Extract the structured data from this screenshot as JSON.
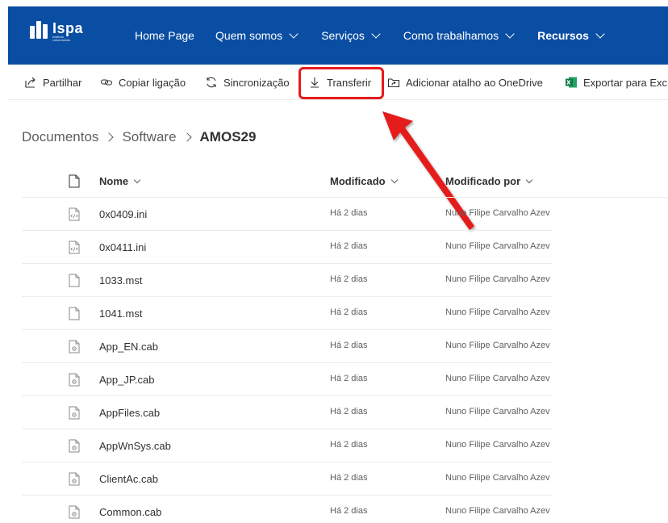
{
  "header": {
    "logo_name": "Ispa",
    "logo_sub_1": "Instituto",
    "logo_sub_2": "Universitário",
    "nav": [
      {
        "label": "Home Page",
        "has_chevron": false,
        "active": false
      },
      {
        "label": "Quem somos",
        "has_chevron": true,
        "active": false
      },
      {
        "label": "Serviços",
        "has_chevron": true,
        "active": false
      },
      {
        "label": "Como trabalhamos",
        "has_chevron": true,
        "active": false
      },
      {
        "label": "Recursos",
        "has_chevron": true,
        "active": true
      }
    ],
    "color": "#0a4ea3"
  },
  "commandbar": {
    "partilhar": {
      "label": "Partilhar",
      "icon": "share-icon"
    },
    "copiar": {
      "label": "Copiar ligação",
      "icon": "link-icon"
    },
    "sincronizacao": {
      "label": "Sincronização",
      "icon": "sync-icon"
    },
    "transferir": {
      "label": "Transferir",
      "icon": "download-icon"
    },
    "onedrive": {
      "label": "Adicionar atalho ao OneDrive",
      "icon": "shortcut-icon"
    },
    "exportar": {
      "label": "Exportar para Exc",
      "icon": "excel-icon"
    }
  },
  "annotation": {
    "color": "#e51b1b",
    "target": "Transferir"
  },
  "breadcrumb": {
    "items": [
      "Documentos",
      "Software"
    ],
    "current": "AMOS29"
  },
  "list": {
    "columns": {
      "name": "Nome",
      "modified": "Modificado",
      "modified_by": "Modificado por"
    },
    "rows": [
      {
        "name": "0x0409.ini",
        "modified": "Há 2 dias",
        "modified_by": "Nuno Filipe Carvalho Azev",
        "icon": "code-file-icon"
      },
      {
        "name": "0x0411.ini",
        "modified": "Há 2 dias",
        "modified_by": "Nuno Filipe Carvalho Azev",
        "icon": "code-file-icon"
      },
      {
        "name": "1033.mst",
        "modified": "Há 2 dias",
        "modified_by": "Nuno Filipe Carvalho Azev",
        "icon": "generic-file-icon"
      },
      {
        "name": "1041.mst",
        "modified": "Há 2 dias",
        "modified_by": "Nuno Filipe Carvalho Azev",
        "icon": "generic-file-icon"
      },
      {
        "name": "App_EN.cab",
        "modified": "Há 2 dias",
        "modified_by": "Nuno Filipe Carvalho Azev",
        "icon": "system-file-icon"
      },
      {
        "name": "App_JP.cab",
        "modified": "Há 2 dias",
        "modified_by": "Nuno Filipe Carvalho Azev",
        "icon": "system-file-icon"
      },
      {
        "name": "AppFiles.cab",
        "modified": "Há 2 dias",
        "modified_by": "Nuno Filipe Carvalho Azev",
        "icon": "system-file-icon"
      },
      {
        "name": "AppWnSys.cab",
        "modified": "Há 2 dias",
        "modified_by": "Nuno Filipe Carvalho Azev",
        "icon": "system-file-icon"
      },
      {
        "name": "ClientAc.cab",
        "modified": "Há 2 dias",
        "modified_by": "Nuno Filipe Carvalho Azev",
        "icon": "system-file-icon"
      },
      {
        "name": "Common.cab",
        "modified": "Há 2 dias",
        "modified_by": "Nuno Filipe Carvalho Azev",
        "icon": "system-file-icon"
      }
    ]
  }
}
